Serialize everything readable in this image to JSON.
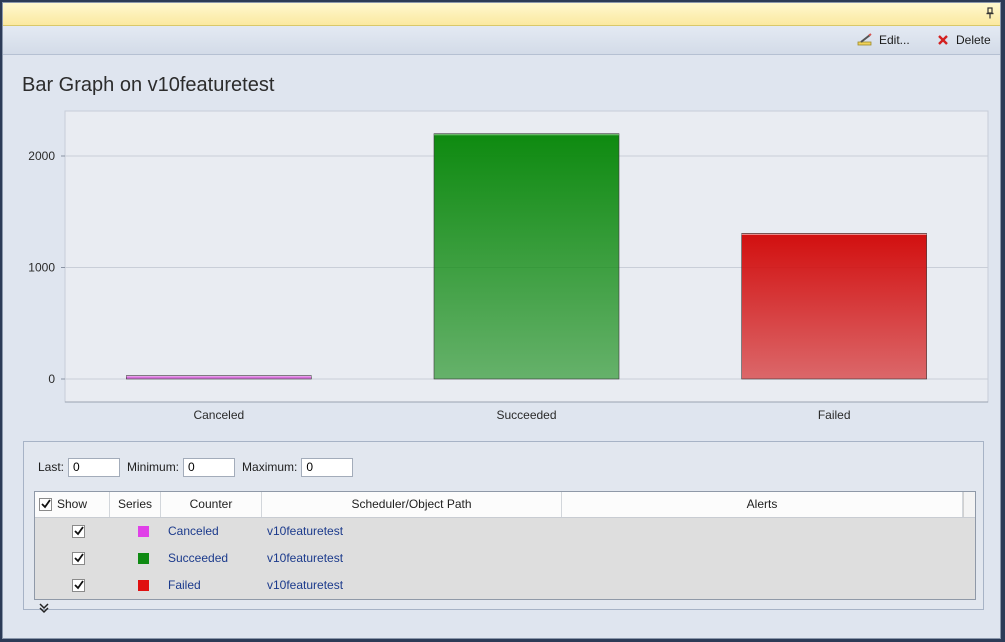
{
  "toolbar": {
    "edit_label": "Edit...",
    "delete_label": "Delete"
  },
  "panel": {
    "title": "Bar Graph on v10featuretest"
  },
  "chart_data": {
    "type": "bar",
    "categories": [
      "Canceled",
      "Succeeded",
      "Failed"
    ],
    "values": [
      30,
      2200,
      1305
    ],
    "colors": [
      "#cf3fd2",
      "#0e8a10",
      "#d20f0f"
    ],
    "ylim": [
      0,
      2400
    ],
    "yticks": [
      0,
      1000,
      2000
    ],
    "grid": true
  },
  "stats": {
    "last_label": "Last:",
    "last_value": "0",
    "min_label": "Minimum:",
    "min_value": "0",
    "max_label": "Maximum:",
    "max_value": "0"
  },
  "table": {
    "headers": {
      "show": "Show",
      "series": "Series",
      "counter": "Counter",
      "path": "Scheduler/Object Path",
      "alerts": "Alerts"
    },
    "rows": [
      {
        "counter": "Canceled",
        "path": "v10featuretest",
        "color": "#e040e8",
        "checked": true
      },
      {
        "counter": "Succeeded",
        "path": "v10featuretest",
        "color": "#0f8a13",
        "checked": true
      },
      {
        "counter": "Failed",
        "path": "v10featuretest",
        "color": "#e01010",
        "checked": true
      }
    ]
  }
}
